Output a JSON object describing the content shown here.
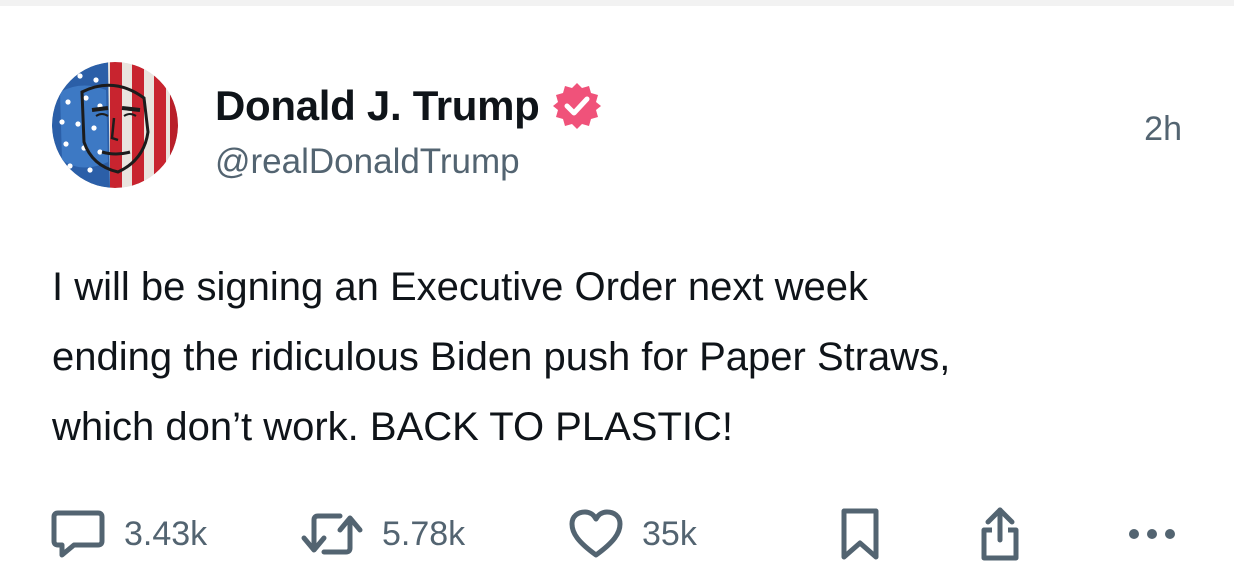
{
  "author": {
    "display_name": "Donald J. Trump",
    "handle": "@realDonaldTrump",
    "verified": true,
    "verified_color": "#f0527a",
    "avatar_icon": "american-flag-portrait-avatar"
  },
  "post": {
    "time": "2h",
    "text": "I will be signing an Executive Order next week\nending the ridiculous Biden push for Paper Straws,\nwhich don’t work. BACK TO PLASTIC!"
  },
  "actions": {
    "reply": {
      "icon": "comment-icon",
      "count": "3.43k"
    },
    "repost": {
      "icon": "repost-icon",
      "count": "5.78k"
    },
    "like": {
      "icon": "heart-icon",
      "count": "35k"
    },
    "bookmark": {
      "icon": "bookmark-icon"
    },
    "share": {
      "icon": "share-icon"
    },
    "more": {
      "icon": "more-dots-icon"
    }
  },
  "colors": {
    "text_primary": "#0f1419",
    "text_secondary": "#536471",
    "icon": "#536471"
  }
}
